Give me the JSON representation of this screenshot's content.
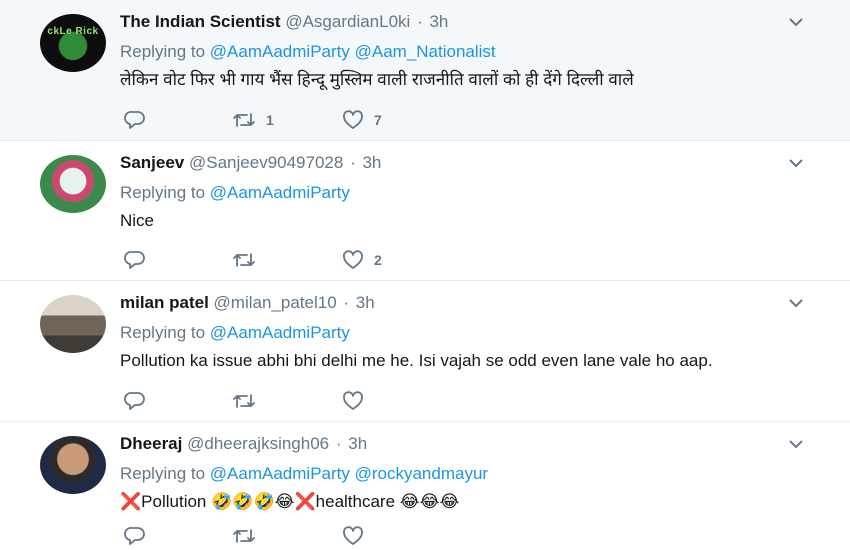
{
  "tweets": [
    {
      "name": "The Indian Scientist",
      "handle": "@AsgardianL0ki",
      "time": "3h",
      "replying_label": "Replying to",
      "mentions": [
        "@AamAadmiParty",
        "@Aam_Nationalist"
      ],
      "text": "लेकिन वोट फिर भी गाय भैंस हिन्दू मुस्लिम वाली राजनीति वालों को ही देंगे दिल्ली वाले",
      "avatar_text": "ckLe Rick",
      "retweets": "1",
      "likes": "7"
    },
    {
      "name": "Sanjeev",
      "handle": "@Sanjeev90497028",
      "time": "3h",
      "replying_label": "Replying to",
      "mentions": [
        "@AamAadmiParty"
      ],
      "text": "Nice",
      "retweets": "",
      "likes": "2"
    },
    {
      "name": "milan patel",
      "handle": "@milan_patel10",
      "time": "3h",
      "replying_label": "Replying to",
      "mentions": [
        "@AamAadmiParty"
      ],
      "text": "Pollution ka issue abhi bhi delhi me he. Isi vajah se odd even lane vale ho aap.",
      "retweets": "",
      "likes": ""
    },
    {
      "name": "Dheeraj",
      "handle": "@dheerajksingh06",
      "time": "3h",
      "replying_label": "Replying to",
      "mentions": [
        "@AamAadmiParty",
        "@rockyandmayur"
      ],
      "text_parts": {
        "x1": "❌",
        "word1": "Pollution ",
        "emoji1": "🤣🤣🤣😂",
        "x2": "❌",
        "word2": "healthcare ",
        "emoji2": "😂😂😂"
      },
      "retweets": "",
      "likes": ""
    }
  ],
  "icons": {
    "reply": "reply-icon",
    "retweet": "retweet-icon",
    "like": "heart-icon",
    "menu": "chevron-down-icon"
  },
  "colors": {
    "link": "#1b95e0",
    "muted": "#657786",
    "text": "#14171a",
    "highlight_bg": "#f5f8fa"
  }
}
